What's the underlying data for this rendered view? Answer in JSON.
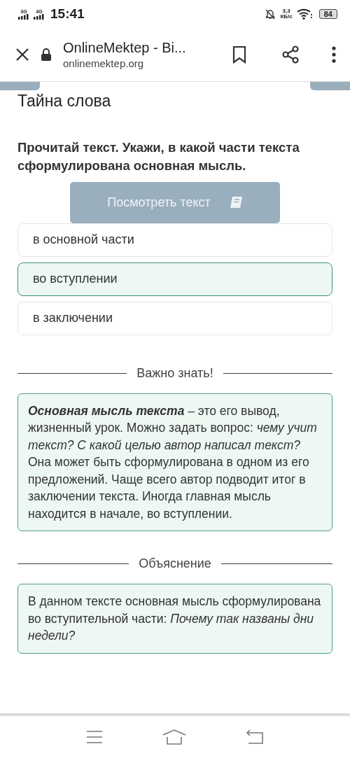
{
  "status_bar": {
    "network_1": "3G",
    "network_2": "4G",
    "time": "15:41",
    "speed_value": "3,3",
    "speed_unit": "КБ/с",
    "battery": "84"
  },
  "browser": {
    "title": "OnlineMektep - Bi...",
    "url": "onlinemektep.org"
  },
  "page": {
    "title": "Тайна слова",
    "question": "Прочитай текст. Укажи, в какой части текста сформулирована основная мысль.",
    "view_button": "Посмотреть текст",
    "options": [
      {
        "label": "в основной части",
        "selected": false
      },
      {
        "label": "во вступлении",
        "selected": true
      },
      {
        "label": "в заключении",
        "selected": false
      }
    ],
    "sections": [
      {
        "heading": "Важно знать!",
        "text": "**Основная мысль текста** – это его вывод, жизненный урок. Можно задать вопрос: *чему учит текст? С какой целью автор написал текст?* Она может быть сформулирована в одном из его предложений. Чаще всего автор подводит итог в заключении текста. Иногда главная мысль находится в начале, во вступлении."
      },
      {
        "heading": "Объяснение",
        "text": "В данном тексте основная мысль сформулирована во вступительной части: *Почему так названы дни недели?*"
      }
    ]
  }
}
